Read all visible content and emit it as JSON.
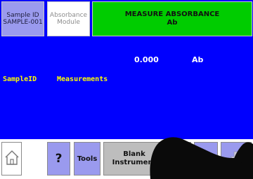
{
  "top": {
    "sample_line1": "Sample ID",
    "sample_line2": "SAMPLE-001",
    "module_line1": "Absorbance",
    "module_line2": "Module",
    "measure_line1": "MEASURE ABSORBANCE",
    "measure_line2": "Ab"
  },
  "readout": {
    "value": "0.000",
    "unit": "Ab"
  },
  "table": {
    "col_sample": "SampleID",
    "col_measure": "Measurements"
  },
  "toolbar": {
    "help_label": "?",
    "tools_label": "Tools",
    "blank_line1": "Blank",
    "blank_line2": "Instrument"
  },
  "colors": {
    "screen": "#0000fe",
    "accent_green": "#00cc00",
    "header_yellow": "#ffff00",
    "button_lilac": "#9a9aee"
  },
  "icons": [
    "home-icon",
    "arrow-up-icon",
    "arrow-down-icon"
  ]
}
